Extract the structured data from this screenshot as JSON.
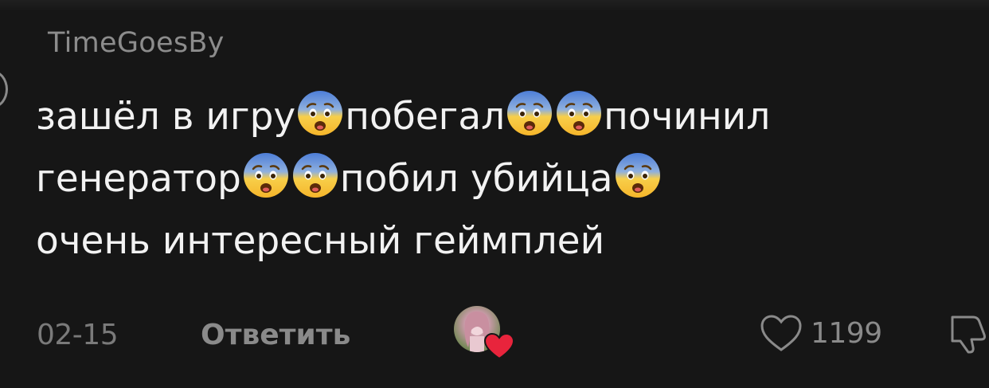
{
  "comment": {
    "username": "TimeGoesBy",
    "text_segments": [
      {
        "line": 1,
        "parts": [
          "зашёл в игру",
          "emoji",
          "побегал",
          "emoji",
          "emoji",
          "починил"
        ]
      },
      {
        "line": 2,
        "parts": [
          "генератор",
          "emoji",
          "emoji",
          "побил убийца",
          "emoji"
        ]
      },
      {
        "line": 3,
        "parts": [
          "очень интересный геймплей"
        ]
      }
    ],
    "line1": {
      "t1": "зашёл в игру",
      "t2": "побегал",
      "t3": "починил"
    },
    "line2": {
      "t1": "генератор",
      "t2": "побил убийца"
    },
    "line3": {
      "t1": "очень интересный геймплей"
    },
    "emoji_name": "fearful-face",
    "date": "02-15",
    "reply_label": "Ответить",
    "like_count": "1199"
  },
  "icons": {
    "like": "heart-outline-icon",
    "dislike": "thumbs-down-icon",
    "creator_like": "creator-liked-heart-icon"
  },
  "colors": {
    "background": "#161616",
    "text": "#f2f2f2",
    "muted": "#8a8a8a",
    "heart_red": "#e8243c"
  }
}
